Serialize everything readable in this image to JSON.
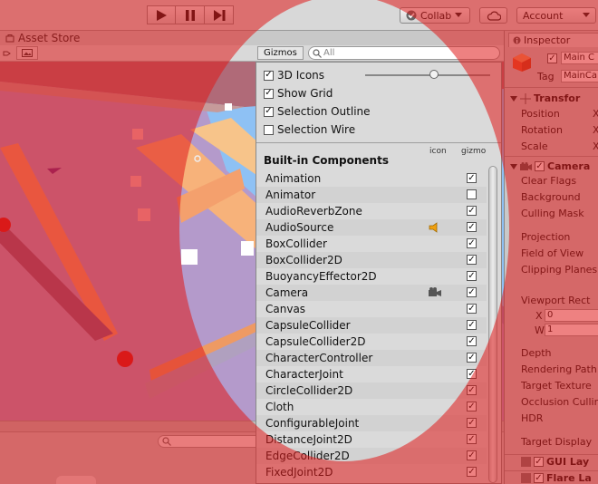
{
  "toolbar": {
    "play_icon": "play-icon",
    "pause_icon": "pause-icon",
    "step_icon": "step-icon",
    "collab_label": "Collab",
    "cloud_icon": "cloud-icon",
    "account_label": "Account"
  },
  "scene": {
    "tab_label": "Asset Store",
    "gizmos_label": "Gizmos",
    "search_placeholder": "All"
  },
  "gizmos_panel": {
    "options": [
      {
        "label": "3D Icons",
        "checked": true
      },
      {
        "label": "Show Grid",
        "checked": true
      },
      {
        "label": "Selection Outline",
        "checked": true
      },
      {
        "label": "Selection Wire",
        "checked": false
      }
    ],
    "icon_size_slider": 0.55,
    "section_title": "Built-in Components",
    "col_icon": "icon",
    "col_gizmo": "gizmo",
    "components": [
      {
        "name": "Animation",
        "gizmo": true,
        "icon": ""
      },
      {
        "name": "Animator",
        "gizmo": false,
        "icon": ""
      },
      {
        "name": "AudioReverbZone",
        "gizmo": true,
        "icon": ""
      },
      {
        "name": "AudioSource",
        "gizmo": true,
        "icon": "speaker-icon"
      },
      {
        "name": "BoxCollider",
        "gizmo": true,
        "icon": ""
      },
      {
        "name": "BoxCollider2D",
        "gizmo": true,
        "icon": ""
      },
      {
        "name": "BuoyancyEffector2D",
        "gizmo": true,
        "icon": ""
      },
      {
        "name": "Camera",
        "gizmo": true,
        "icon": "camera-icon"
      },
      {
        "name": "Canvas",
        "gizmo": true,
        "icon": ""
      },
      {
        "name": "CapsuleCollider",
        "gizmo": true,
        "icon": ""
      },
      {
        "name": "CapsuleCollider2D",
        "gizmo": true,
        "icon": ""
      },
      {
        "name": "CharacterController",
        "gizmo": true,
        "icon": ""
      },
      {
        "name": "CharacterJoint",
        "gizmo": true,
        "icon": ""
      },
      {
        "name": "CircleCollider2D",
        "gizmo": true,
        "icon": ""
      },
      {
        "name": "Cloth",
        "gizmo": true,
        "icon": ""
      },
      {
        "name": "ConfigurableJoint",
        "gizmo": true,
        "icon": ""
      },
      {
        "name": "DistanceJoint2D",
        "gizmo": true,
        "icon": ""
      },
      {
        "name": "EdgeCollider2D",
        "gizmo": true,
        "icon": ""
      },
      {
        "name": "FixedJoint2D",
        "gizmo": true,
        "icon": ""
      }
    ]
  },
  "inspector": {
    "tab_label": "Inspector",
    "object_name": "Main C",
    "tag_label": "Tag",
    "tag_value": "MainCa",
    "transform_title": "Transfor",
    "transform_rows": [
      "Position",
      "Rotation",
      "Scale"
    ],
    "transform_x": "X",
    "camera_title": "Camera",
    "camera_rows": [
      "Clear Flags",
      "Background",
      "Culling Mask",
      "Projection",
      "Field of View",
      "Clipping Planes",
      "Viewport Rect"
    ],
    "viewport_x_label": "X",
    "viewport_x_value": "0",
    "viewport_w_label": "W",
    "viewport_w_value": "1",
    "camera_rows_2": [
      "Depth",
      "Rendering Path",
      "Target Texture",
      "Occlusion Culling",
      "HDR",
      "Target Display"
    ],
    "gui_layer_title": "GUI Lay",
    "flare_layer_title": "Flare La"
  }
}
